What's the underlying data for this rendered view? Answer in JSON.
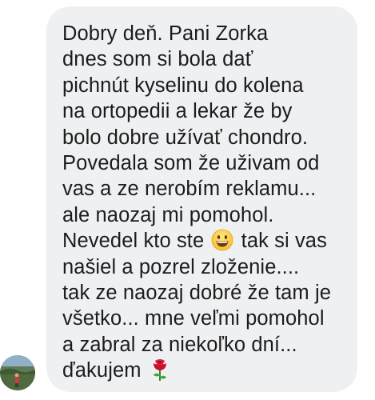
{
  "message": {
    "lines": [
      "Dobry deň. Pani Zorka",
      "dnes som si bola dať",
      "pichnút kyselinu do kolena",
      "na ortopedii a lekar že by",
      "bolo dobre užívať chondro.",
      "Povedala som že uživam od",
      "vas a ze nerobím reklamu...",
      "ale naozaj mi pomohol.",
      "Nevedel kto ste",
      "tak si vas",
      "našiel a pozrel zloženie....",
      "tak ze naozaj dobré že tam je",
      "všetko... mne veľmi pomohol",
      "a zabral za niekoľko dní...",
      "ďakujem"
    ]
  },
  "icons": {
    "smile_emoji": "grinning-face-emoji",
    "rose_emoji": "rose-emoji",
    "avatar": "sender-avatar"
  },
  "colors": {
    "bubble_background": "#eff0f2",
    "text": "#1c1c1c"
  }
}
